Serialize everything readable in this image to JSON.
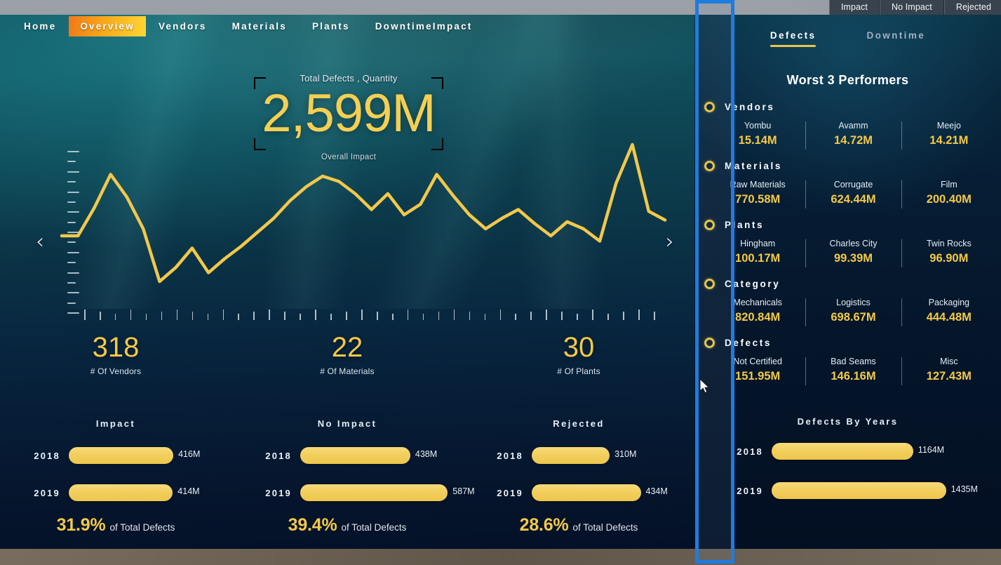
{
  "topbar": {
    "slicers": [
      "Impact",
      "No Impact",
      "Rejected"
    ]
  },
  "nav": {
    "items": [
      "Home",
      "Overview",
      "Vendors",
      "Materials",
      "Plants",
      "DowntimeImpact"
    ],
    "active": "Overview"
  },
  "kpi": {
    "title": "Total Defects , Quantity",
    "value": "2,599M",
    "subtitle": "Overall Impact"
  },
  "carousel": {
    "prev_icon": "chevron-left-icon",
    "next_icon": "chevron-right-icon",
    "prev": "‹",
    "next": "›"
  },
  "counters": [
    {
      "value": "318",
      "label": "# Of Vendors"
    },
    {
      "value": "22",
      "label": "# Of Materials"
    },
    {
      "value": "30",
      "label": "# Of Plants"
    }
  ],
  "bar_groups": [
    {
      "title": "Impact",
      "rows": [
        {
          "year": "2018",
          "value": "416M",
          "num": 416
        },
        {
          "year": "2019",
          "value": "414M",
          "num": 414
        }
      ],
      "pct": "31.9%",
      "pct_text": "of Total Defects"
    },
    {
      "title": "No Impact",
      "rows": [
        {
          "year": "2018",
          "value": "438M",
          "num": 438
        },
        {
          "year": "2019",
          "value": "587M",
          "num": 587
        }
      ],
      "pct": "39.4%",
      "pct_text": "of Total Defects"
    },
    {
      "title": "Rejected",
      "rows": [
        {
          "year": "2018",
          "value": "310M",
          "num": 310
        },
        {
          "year": "2019",
          "value": "434M",
          "num": 434
        }
      ],
      "pct": "28.6%",
      "pct_text": "of Total Defects"
    }
  ],
  "right_panel": {
    "tabs": [
      {
        "label": "Defects",
        "active": true
      },
      {
        "label": "Downtime",
        "active": false
      }
    ],
    "heading": "Worst 3 Performers",
    "groups": [
      {
        "name": "Vendors",
        "items": [
          {
            "name": "Yombu",
            "value": "15.14M"
          },
          {
            "name": "Avamm",
            "value": "14.72M"
          },
          {
            "name": "Meejo",
            "value": "14.21M"
          }
        ]
      },
      {
        "name": "Materials",
        "items": [
          {
            "name": "Raw Materials",
            "value": "770.58M"
          },
          {
            "name": "Corrugate",
            "value": "624.44M"
          },
          {
            "name": "Film",
            "value": "200.40M"
          }
        ]
      },
      {
        "name": "Plants",
        "items": [
          {
            "name": "Hingham",
            "value": "100.17M"
          },
          {
            "name": "Charles City",
            "value": "99.39M"
          },
          {
            "name": "Twin Rocks",
            "value": "96.90M"
          }
        ]
      },
      {
        "name": "Category",
        "items": [
          {
            "name": "Mechanicals",
            "value": "820.84M"
          },
          {
            "name": "Logistics",
            "value": "698.67M"
          },
          {
            "name": "Packaging",
            "value": "444.48M"
          }
        ]
      },
      {
        "name": "Defects",
        "items": [
          {
            "name": "Not Certified",
            "value": "151.95M"
          },
          {
            "name": "Bad Seams",
            "value": "146.16M"
          },
          {
            "name": "Misc",
            "value": "127.43M"
          }
        ]
      }
    ],
    "defects_by_years": {
      "title": "Defects By Years",
      "rows": [
        {
          "year": "2018",
          "value": "1164M",
          "num": 1164
        },
        {
          "year": "2019",
          "value": "1435M",
          "num": 1435
        }
      ]
    }
  },
  "selection": {
    "highlight_box": "blue-selection-rectangle",
    "accent": "#1e7ce0"
  },
  "colors": {
    "gold": "#f3c948",
    "bar": "#f2cd5b",
    "nav_active_start": "#f07818",
    "nav_active_end": "#ffd634",
    "highlight": "#1e7ce0"
  },
  "chart_data": [
    {
      "type": "line",
      "title": "Total Defects , Quantity",
      "xlabel": "",
      "ylabel": "",
      "grid": false,
      "legend": "none",
      "x": [
        1,
        2,
        3,
        4,
        5,
        6,
        7,
        8,
        9,
        10,
        11,
        12,
        13,
        14,
        15,
        16,
        17,
        18,
        19,
        20,
        21,
        22,
        23,
        24,
        25,
        26,
        27,
        28,
        29,
        30,
        31,
        32,
        33,
        34,
        35,
        36,
        37,
        38
      ],
      "series": [
        {
          "name": "Total Defects",
          "values": [
            48,
            48,
            64,
            83,
            70,
            52,
            22,
            30,
            41,
            27,
            35,
            42,
            50,
            58,
            68,
            76,
            82,
            79,
            72,
            63,
            72,
            60,
            66,
            83,
            71,
            60,
            52,
            58,
            63,
            55,
            48,
            56,
            52,
            45,
            78,
            100,
            62,
            57
          ]
        }
      ],
      "ylim": [
        0,
        100
      ],
      "n_xticks": 38
    },
    {
      "type": "bar",
      "title": "Impact",
      "orientation": "horizontal",
      "categories": [
        "2018",
        "2019"
      ],
      "values": [
        416,
        414
      ],
      "value_labels": [
        "416M",
        "414M"
      ],
      "annotation": "31.9% of Total Defects"
    },
    {
      "type": "bar",
      "title": "No Impact",
      "orientation": "horizontal",
      "categories": [
        "2018",
        "2019"
      ],
      "values": [
        438,
        587
      ],
      "value_labels": [
        "438M",
        "587M"
      ],
      "annotation": "39.4% of Total Defects"
    },
    {
      "type": "bar",
      "title": "Rejected",
      "orientation": "horizontal",
      "categories": [
        "2018",
        "2019"
      ],
      "values": [
        310,
        434
      ],
      "value_labels": [
        "310M",
        "434M"
      ],
      "annotation": "28.6% of Total Defects"
    },
    {
      "type": "bar",
      "title": "Defects By Years",
      "orientation": "horizontal",
      "categories": [
        "2018",
        "2019"
      ],
      "values": [
        1164,
        1435
      ],
      "value_labels": [
        "1164M",
        "1435M"
      ]
    }
  ]
}
